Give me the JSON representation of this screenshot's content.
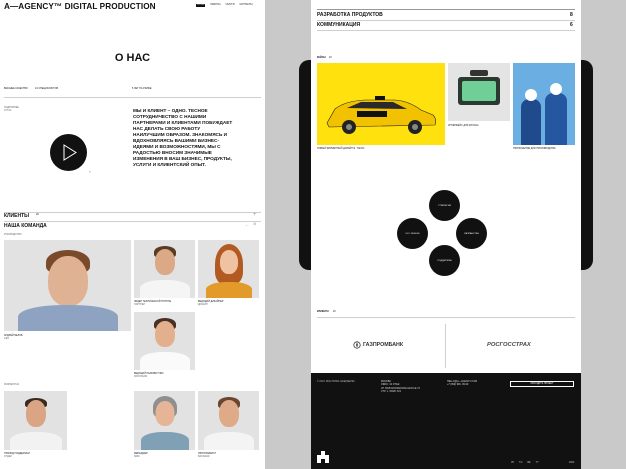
{
  "left": {
    "logo": "A—AGENCY™ DIGITAL PRODUCTION",
    "nav": [
      {
        "label": "О НАС",
        "active": true
      },
      {
        "label": "РАБОТЫ",
        "active": false
      },
      {
        "label": "УСЛУГИ",
        "active": false
      },
      {
        "label": "КОНТАКТЫ",
        "active": false
      }
    ],
    "title": "О НАС",
    "stats": [
      "ВЫСШЕЕ КАЧЕСТВО",
      "24 СПЕЦИАЛИСТОВ",
      "5 ЛЕТ НА РЫНКЕ"
    ],
    "small_note": [
      "ПОДРОБНЕЕ",
      "О НАС"
    ],
    "intro": "МЫ И КЛИЕНТ – ОДНО. ТЕСНОЕ СОТРУДНИЧЕСТВО С НАШИМИ ПАРТНЕРАМИ И КЛИЕНТАМИ ПОБУЖДАЕТ НАС ДЕЛАТЬ СВОЮ РАБОТУ НАИЛУЧШИМ ОБРАЗОМ. ЗНАКОМЯСЬ И ВДОХНОВЛЯЯСЬ ВАШИМИ БИЗНЕС-ИДЕЯМИ И ВОЗМОЖНОСТЯМИ, МЫ С РАДОСТЬЮ ВНОСИМ ЗНАЧИМЫЕ ИЗМЕНЕНИЯ В ВАШ БИЗНЕС, ПРОДУКТЫ, УСЛУГИ И КЛИЕНТСКИЙ ОПЫТ.",
    "clients_label": "КЛИЕНТЫ",
    "clients_count": "20",
    "team_label": "НАША КОМАНДА",
    "team_sublabel": "РУКОВОДСТВО",
    "team_sublabel_2": "РАЗРАБОТКА",
    "members": [
      {
        "name": "АНДРЕЙ БЕЛОВ",
        "role": "CEO"
      },
      {
        "name": "ЛИДЕР ТЕХНИЧЕСКОЙ ГРУППЫ",
        "role": "ПАРТНЕР"
      },
      {
        "name": "ВЕДУЩИЙ ДИЗАЙНЕР",
        "role": "ДИЗАЙН"
      },
      {
        "name": "ВЕДУЩИЙ РАЗРАБОТЧИК",
        "role": "FRONTEND"
      },
      {
        "name": "ТИМЛИД ПОДДЕРЖКИ",
        "role": "ОТДЕЛ"
      },
      {
        "name": "МЕНЕДЖЕР",
        "role": "SMM"
      },
      {
        "name": "ПРОГРАММИСТ",
        "role": "BACKEND"
      }
    ]
  },
  "right": {
    "services": [
      {
        "label": "РАЗРАБОТКА ПРОДУКТОВ",
        "count": "8"
      },
      {
        "label": "КОММУНИКАЦИЯ",
        "count": "6"
      }
    ],
    "cases_label": "КЕЙСЫ",
    "cases_count": "20",
    "cases": [
      {
        "caption": "НОВЫЙ ФИРМЕННЫЙ ДИЗАЙН Я. ТАКСИ"
      },
      {
        "caption": "ИНТЕРФЕЙС ДЛЯ КИОСКА"
      },
      {
        "caption": "ПРИЛОЖЕНИЕ ДЛЯ ПРОИЗВОДСТВА"
      }
    ],
    "circles": [
      "СТРАТЕГИЯ",
      "UX / DESIGN",
      "РАЗРАБОТКА",
      "ПОДДЕРЖКА"
    ],
    "clients_label": "КЛИЕНТЫ",
    "clients_count": "20",
    "logos": [
      "ГАЗПРОМБАНК",
      "РОСГОССТРАХ"
    ],
    "footer": {
      "copyright": "© 2023. ВСЕ ПРАВА ЗАЩИЩЕНЫ",
      "address": [
        "МОСКВА",
        "ОФИС: 10 ЭТАЖ",
        "УЛ. ВОЛОКОЛАМСКОЕ ШОССЕ 73",
        "СТР. 1, ОФИС 301"
      ],
      "contacts": [
        "HELLO@A—AGENCY.COM",
        "+7 (999) 999 -99-99"
      ],
      "cta": "ОБСУДИТЬ ПРОЕКТ",
      "socials": [
        "VK",
        "TG",
        "BE",
        "YT"
      ],
      "year": "2023"
    }
  },
  "colors": {
    "accent_yellow": "#ffe10d",
    "dark": "#111111"
  }
}
